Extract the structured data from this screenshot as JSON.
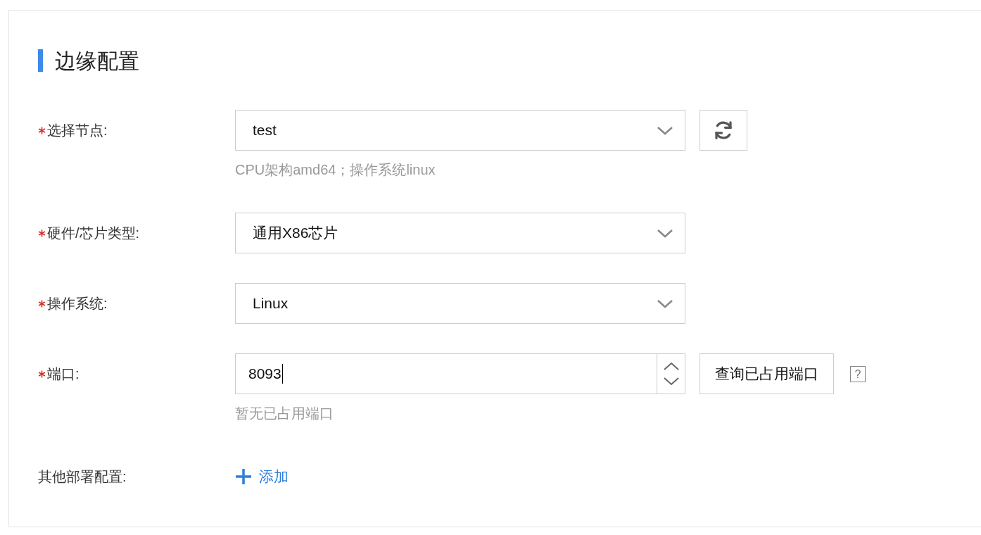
{
  "section": {
    "title": "边缘配置"
  },
  "fields": [
    {
      "kind": "select",
      "label": "选择节点:",
      "required": true,
      "value": "test",
      "hint": "CPU架构amd64；操作系统linux",
      "refresh": true
    },
    {
      "kind": "select",
      "label": "硬件/芯片类型:",
      "required": true,
      "value": "通用X86芯片"
    },
    {
      "kind": "select",
      "label": "操作系统:",
      "required": true,
      "value": "Linux"
    },
    {
      "kind": "number",
      "label": "端口:",
      "required": true,
      "value": "8093",
      "button": "查询已占用端口",
      "help": "?",
      "hint": "暂无已占用端口"
    },
    {
      "kind": "add",
      "label": "其他部署配置:",
      "required": false,
      "link": "添加"
    }
  ]
}
